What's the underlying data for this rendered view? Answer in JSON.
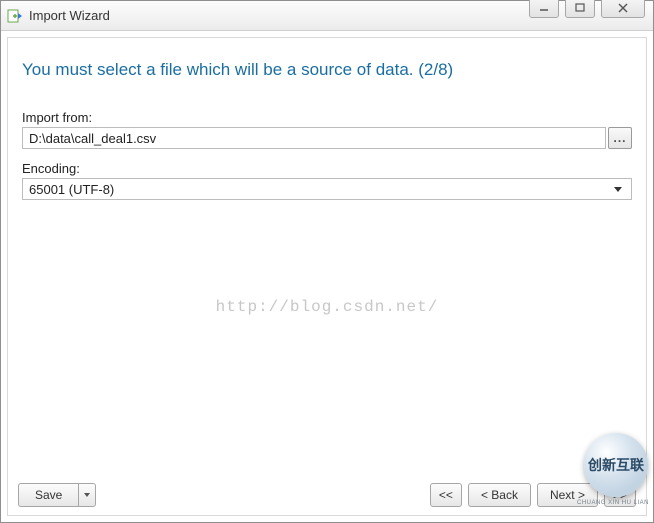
{
  "window": {
    "title": "Import Wizard"
  },
  "heading": "You must select a file which will be a source of data. (2/8)",
  "fields": {
    "importFrom": {
      "label": "Import from:",
      "value": "D:\\data\\call_deal1.csv",
      "browseGlyph": "..."
    },
    "encoding": {
      "label": "Encoding:",
      "value": "65001 (UTF-8)"
    }
  },
  "watermark": "http://blog.csdn.net/",
  "footer": {
    "save": "Save",
    "first": "<<",
    "back": "< Back",
    "next": "Next >",
    "last": ">>"
  },
  "logo": {
    "main": "创新互联",
    "sub": "CHUANG XIN HU LIAN"
  }
}
